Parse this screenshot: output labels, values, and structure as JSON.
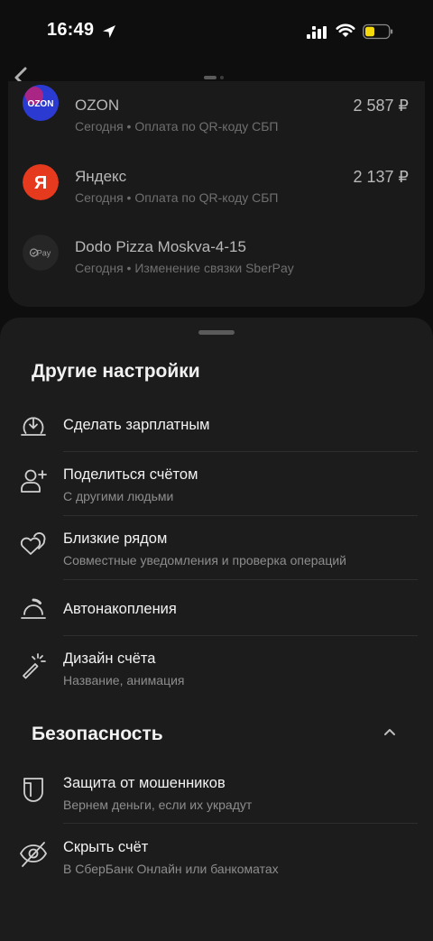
{
  "status_bar": {
    "time": "16:49"
  },
  "operations": [
    {
      "name": "OZON",
      "subtitle": "Сегодня • Оплата по QR-коду СБП",
      "amount": "2 587 ₽",
      "logo": "OZON"
    },
    {
      "name": "Яндекс",
      "subtitle": "Сегодня • Оплата по QR-коду СБП",
      "amount": "2 137 ₽",
      "logo": "Я"
    },
    {
      "name": "Dodo Pizza Moskva-4-15",
      "subtitle": "Сегодня • Изменение связки SberPay",
      "amount": "",
      "logo": "Pay"
    }
  ],
  "other_settings": {
    "title": "Другие настройки",
    "items": [
      {
        "title": "Сделать зарплатным",
        "subtitle": "",
        "icon": "download-circle-icon"
      },
      {
        "title": "Поделиться счётом",
        "subtitle": "С другими людьми",
        "icon": "add-user-icon"
      },
      {
        "title": "Близкие рядом",
        "subtitle": "Совместные уведомления и проверка операций",
        "icon": "hearts-icon"
      },
      {
        "title": "Автонакопления",
        "subtitle": "",
        "icon": "gauge-icon"
      },
      {
        "title": "Дизайн счёта",
        "subtitle": "Название, анимация",
        "icon": "magic-wand-icon"
      }
    ]
  },
  "security": {
    "title": "Безопасность",
    "items": [
      {
        "title": "Защита от мошенников",
        "subtitle": "Вернем деньги, если их украдут",
        "icon": "shield-icon"
      },
      {
        "title": "Скрыть счёт",
        "subtitle": "В СберБанк Онлайн или банкоматах",
        "icon": "eye-off-icon"
      }
    ]
  },
  "colors": {
    "sheet": "#1c1c1c",
    "card": "#1a1a1a",
    "ozon": "#2b3ad1",
    "yandex": "#e53a1e",
    "battery": "#f5d90a"
  }
}
